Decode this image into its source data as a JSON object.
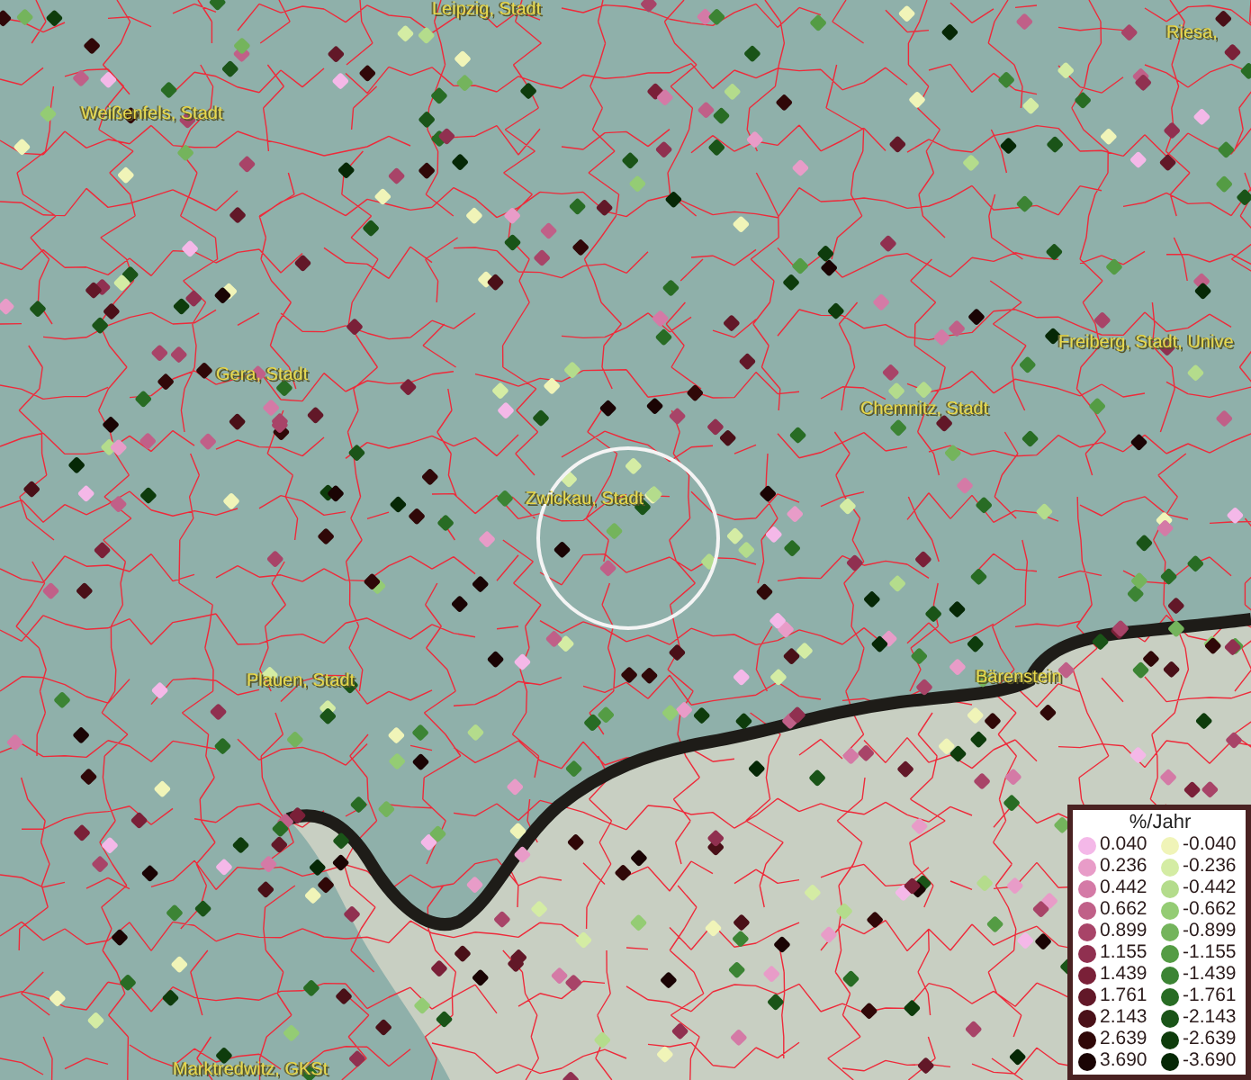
{
  "map": {
    "places": [
      {
        "kind": "city",
        "name": "Leipzig, Stadt"
      },
      {
        "kind": "city",
        "name": "Riesa,"
      },
      {
        "kind": "city",
        "name": "Weißenfels, Stadt"
      },
      {
        "kind": "city",
        "name": "Gera, Stadt"
      },
      {
        "kind": "city",
        "name": "Freiberg, Stadt, Unive"
      },
      {
        "kind": "city",
        "name": "Chemnitz, Stadt"
      },
      {
        "kind": "city",
        "name": "Zwickau, Stadt"
      },
      {
        "kind": "city",
        "name": "Plauen, Stadt"
      },
      {
        "kind": "city",
        "name": "Bärenstein"
      },
      {
        "kind": "city",
        "name": "Marktredwitz, GKSt"
      }
    ]
  },
  "legend": {
    "title": "%/Jahr",
    "rows": [
      {
        "positive": {
          "label": "0.040",
          "color": "#f4b8e8"
        },
        "negative": {
          "label": "-0.040",
          "color": "#f0f4b8"
        }
      },
      {
        "positive": {
          "label": "0.236",
          "color": "#e89cc8"
        },
        "negative": {
          "label": "-0.236",
          "color": "#d4eca4"
        }
      },
      {
        "positive": {
          "label": "0.442",
          "color": "#d47aa6"
        },
        "negative": {
          "label": "-0.442",
          "color": "#b4dc8c"
        }
      },
      {
        "positive": {
          "label": "0.662",
          "color": "#c06088"
        },
        "negative": {
          "label": "-0.662",
          "color": "#94cc74"
        }
      },
      {
        "positive": {
          "label": "0.899",
          "color": "#a84468"
        },
        "negative": {
          "label": "-0.899",
          "color": "#74b45c"
        }
      },
      {
        "positive": {
          "label": "1.155",
          "color": "#903050"
        },
        "negative": {
          "label": "-1.155",
          "color": "#549c44"
        }
      },
      {
        "positive": {
          "label": "1.439",
          "color": "#7a2038"
        },
        "negative": {
          "label": "-1.439",
          "color": "#3c8434"
        }
      },
      {
        "positive": {
          "label": "1.761",
          "color": "#621828"
        },
        "negative": {
          "label": "-1.761",
          "color": "#286c24"
        }
      },
      {
        "positive": {
          "label": "2.143",
          "color": "#4a1018"
        },
        "negative": {
          "label": "-2.143",
          "color": "#1a5418"
        }
      },
      {
        "positive": {
          "label": "2.639",
          "color": "#300808"
        },
        "negative": {
          "label": "-2.639",
          "color": "#0e3c0c"
        }
      },
      {
        "positive": {
          "label": "3.690",
          "color": "#1a0404"
        },
        "negative": {
          "label": "-3.690",
          "color": "#062806"
        }
      }
    ]
  }
}
